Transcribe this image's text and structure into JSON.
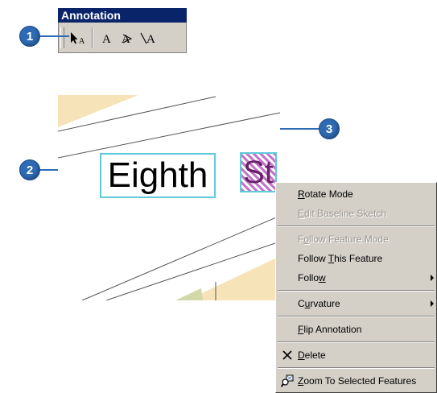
{
  "toolbar": {
    "title": "Annotation",
    "tools": [
      {
        "icon": "edit-annotation-tool-icon"
      },
      {
        "icon": "horizontal-text-icon"
      },
      {
        "icon": "straight-text-icon"
      },
      {
        "icon": "curved-text-icon"
      }
    ]
  },
  "callouts": [
    "1",
    "2",
    "3"
  ],
  "map": {
    "label_eighth": "Eighth",
    "label_st": "St"
  },
  "colors": {
    "selection_outline": "#5fcad9",
    "callout_blue": "#2f6bb5",
    "parcel_tan": "#f7e3b8",
    "parcel_green": "#d2d8a8",
    "menu_face": "#d4d0c8",
    "toolbar_title": "#0a246a"
  },
  "context_menu": {
    "items": [
      {
        "label": "Rotate Mode",
        "mnemonic": "R",
        "enabled": true
      },
      {
        "label": "Edit Baseline Sketch",
        "mnemonic": "E",
        "enabled": false
      },
      {
        "label": "Follow Feature Mode",
        "mnemonic": "o",
        "enabled": false
      },
      {
        "label": "Follow This Feature",
        "mnemonic": "T",
        "enabled": true
      },
      {
        "label": "Follow",
        "mnemonic": "w",
        "enabled": true,
        "submenu": true
      },
      {
        "label": "Curvature",
        "mnemonic": "u",
        "enabled": true,
        "submenu": true
      },
      {
        "label": "Flip Annotation",
        "mnemonic": "F",
        "enabled": true
      },
      {
        "label": "Delete",
        "mnemonic": "D",
        "enabled": true,
        "icon": "delete-x-icon"
      },
      {
        "label": "Zoom To Selected Features",
        "mnemonic": "Z",
        "enabled": true,
        "icon": "zoom-to-selected-icon"
      }
    ]
  }
}
